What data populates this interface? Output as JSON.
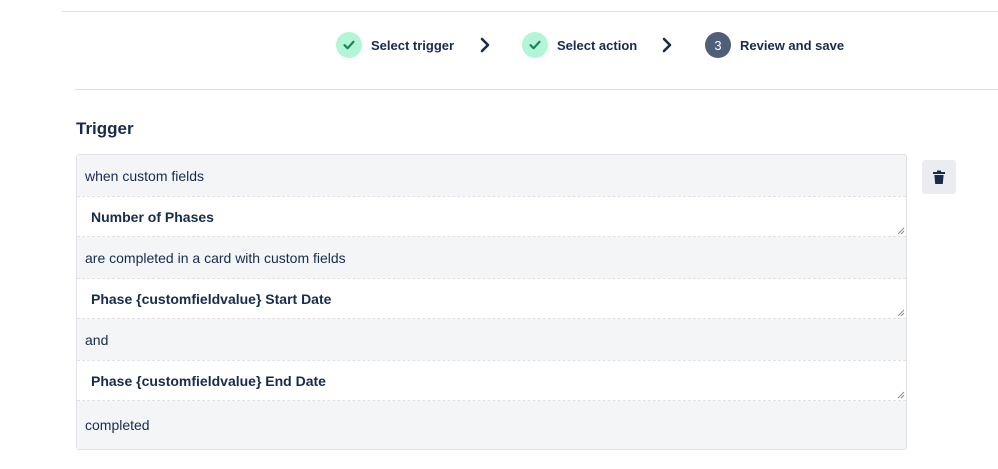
{
  "stepper": {
    "steps": [
      {
        "label": "Select trigger",
        "status": "done",
        "icon": "check-icon"
      },
      {
        "label": "Select action",
        "status": "done",
        "icon": "check-icon"
      },
      {
        "label": "Review and save",
        "status": "current",
        "number": "3"
      }
    ],
    "separator_icon": "chevron-right-icon"
  },
  "trigger": {
    "title": "Trigger",
    "rows": [
      {
        "kind": "text",
        "text": "when custom fields"
      },
      {
        "kind": "field",
        "text": "Number of Phases"
      },
      {
        "kind": "text",
        "text": "are completed in a card with custom fields"
      },
      {
        "kind": "field",
        "text": "Phase {customfieldvalue} Start Date"
      },
      {
        "kind": "text",
        "text": "and"
      },
      {
        "kind": "field",
        "text": "Phase {customfieldvalue} End Date"
      },
      {
        "kind": "text",
        "text": "completed"
      }
    ],
    "delete_icon": "trash-icon"
  },
  "colors": {
    "step_done": "#b3f5d7",
    "step_done_check": "#1f845a",
    "step_current": "#505f79",
    "text": "#172b4d",
    "row_background": "#f4f5f7",
    "field_background": "#ffffff",
    "delete_button": "#ebecf0"
  }
}
